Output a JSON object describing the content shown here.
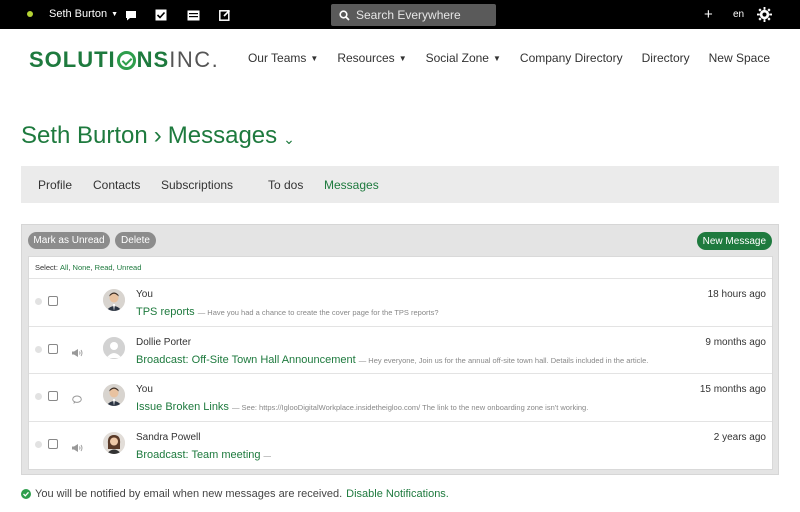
{
  "topbar": {
    "user_name": "Seth Burton",
    "search_placeholder": "Search Everywhere",
    "lang": "en",
    "icons": [
      "chat-icon",
      "checkbox-icon",
      "inbox-icon",
      "edit-icon",
      "plus-icon",
      "gear-icon"
    ]
  },
  "logo": {
    "main_part1": "SOLUTI",
    "main_part2": "NS",
    "suffix": "INC."
  },
  "nav": {
    "items": [
      {
        "label": "Our Teams",
        "dropdown": true
      },
      {
        "label": "Resources",
        "dropdown": true
      },
      {
        "label": "Social Zone",
        "dropdown": true
      },
      {
        "label": "Company Directory",
        "dropdown": false
      },
      {
        "label": "Directory",
        "dropdown": false
      },
      {
        "label": "New Space",
        "dropdown": false
      }
    ]
  },
  "page": {
    "owner": "Seth Burton",
    "separator": "›",
    "title": "Messages"
  },
  "tabs": [
    "Profile",
    "Contacts",
    "Subscriptions",
    "To dos",
    "Messages"
  ],
  "active_tab": "Messages",
  "toolbar": {
    "mark_unread": "Mark as Unread",
    "delete": "Delete",
    "new_message": "New Message"
  },
  "select": {
    "prefix": "Select:",
    "all": "All",
    "none": "None",
    "read": "Read",
    "unread": "Unread"
  },
  "messages": [
    {
      "sender": "You",
      "time": "18 hours ago",
      "subject": "TPS reports",
      "preview": "— Have you had a chance to create the cover page for the TPS reports?",
      "type_icon": "none",
      "avatar": "male-avatar"
    },
    {
      "sender": "Dollie Porter",
      "time": "9 months ago",
      "subject": "Broadcast: Off-Site Town Hall Announcement",
      "preview": "— Hey everyone, Join us for the annual off-site town hall. Details included in the article.",
      "type_icon": "megaphone-icon",
      "avatar": "placeholder-avatar"
    },
    {
      "sender": "You",
      "time": "15 months ago",
      "subject": "Issue Broken Links",
      "preview": "— See: https://IglooDigitalWorkplace.insidetheigloo.com/ The link to the new onboarding zone isn't working.",
      "type_icon": "speech-bubble-icon",
      "avatar": "male-avatar"
    },
    {
      "sender": "Sandra Powell",
      "time": "2 years ago",
      "subject": "Broadcast: Team meeting",
      "preview": "—",
      "type_icon": "megaphone-icon",
      "avatar": "female-avatar"
    }
  ],
  "footer": {
    "notice": "You will be notified by email when new messages are received.",
    "link": "Disable Notifications."
  },
  "colors": {
    "brand_green": "#1e7a3e",
    "topbar": "#000000",
    "panel": "#e4e4e4"
  }
}
